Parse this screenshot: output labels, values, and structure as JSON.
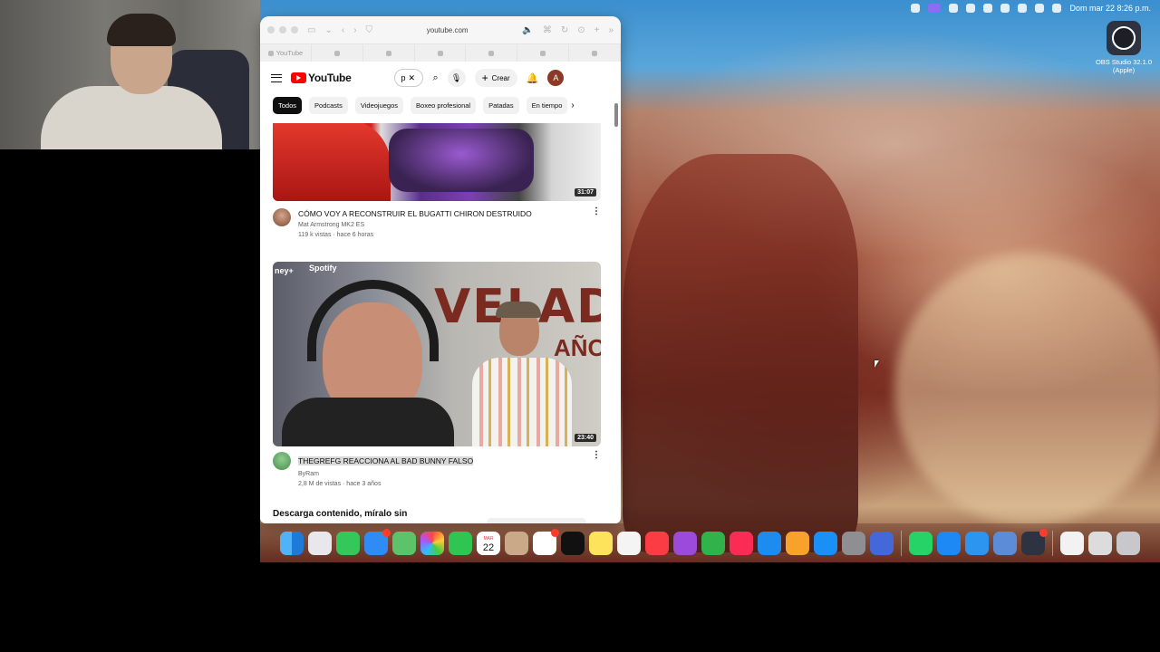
{
  "menubar": {
    "datetime": "Dom mar 22  8:26 p.m."
  },
  "desktop": {
    "obs_label": "OBS Studio 32.1.0 (Apple)"
  },
  "browser": {
    "url": "youtube.com",
    "tabs": [
      {
        "label": "YouTube"
      },
      {
        "label": ""
      },
      {
        "label": ""
      },
      {
        "label": ""
      },
      {
        "label": ""
      },
      {
        "label": ""
      },
      {
        "label": ""
      }
    ]
  },
  "youtube": {
    "logo_text": "YouTube",
    "search_value": "p",
    "create_label": "Crear",
    "avatar_letter": "A",
    "chips": [
      "Todos",
      "Podcasts",
      "Videojuegos",
      "Boxeo profesional",
      "Patadas",
      "En tiempo"
    ],
    "videos": [
      {
        "title": "CÓMO VOY A RECONSTRUIR EL BUGATTI CHIRON DESTRUIDO",
        "channel": "Mat Armstrong MK2 ES",
        "stats": "119 k vistas · hace 6 horas",
        "duration": "31:07"
      },
      {
        "title": "THEGREFG REACCIONA AL BAD BUNNY FALSO",
        "channel": "ByRam",
        "stats": "2,8 M de vistas · hace 3 años",
        "duration": "23:40",
        "thumb_text_1": "VELAD",
        "thumb_text_2": "AÑO",
        "thumb_brand_1": "Spotify",
        "thumb_brand_2": "ney+"
      }
    ],
    "section_title": "Descarga contenido, míralo sin"
  },
  "dock": {
    "calendar_day": "22",
    "calendar_month": "MAR",
    "items": [
      "finder-icon",
      "launchpad-icon",
      "messages-icon",
      "mail-icon",
      "maps-icon",
      "photos-icon",
      "facetime-icon",
      "calendar-icon",
      "contacts-icon",
      "reminders-icon",
      "tv-icon",
      "notes-icon",
      "freeform-icon",
      "music-icon",
      "podcasts-icon",
      "numbers-icon",
      "news-icon",
      "keynote-icon",
      "pages-icon",
      "appstore-icon",
      "settings-icon",
      "preview-icon",
      "whatsapp-icon",
      "safari-icon",
      "vpn-icon",
      "finder-app-icon",
      "obs-icon",
      "documents-icon",
      "keyboard-icon",
      "trash-icon"
    ]
  }
}
